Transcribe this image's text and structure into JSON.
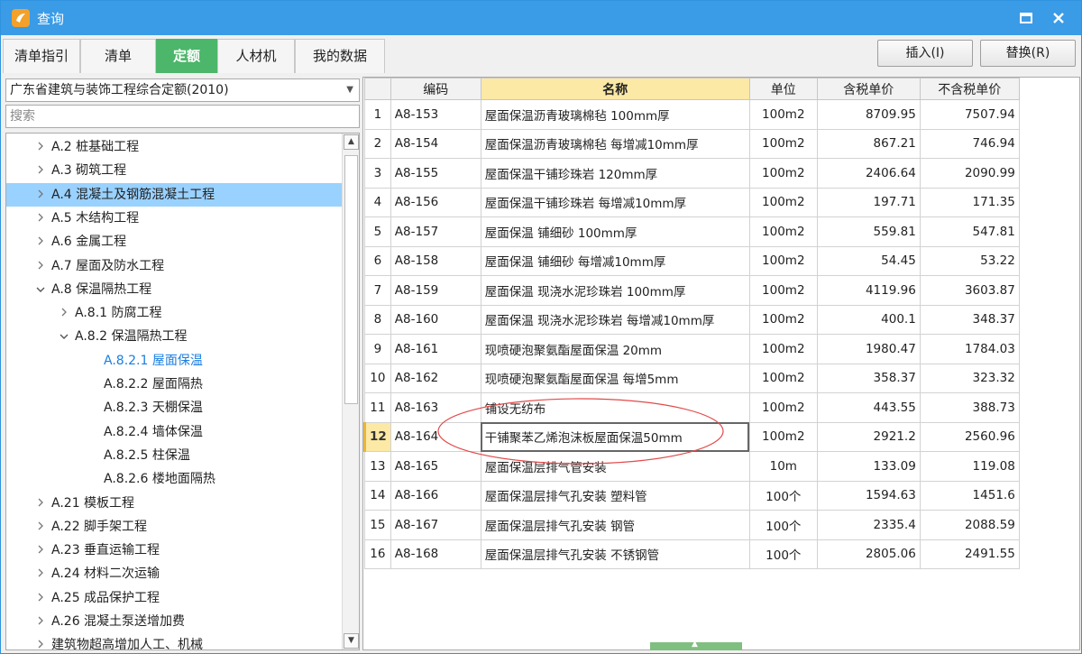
{
  "window": {
    "title": "查询",
    "title_bar_color": "#3a9be7",
    "maximize_icon": "maximize-icon",
    "close_icon": "close-icon"
  },
  "tabs": [
    {
      "label": "清单指引",
      "active": false
    },
    {
      "label": "清单",
      "active": false
    },
    {
      "label": "定额",
      "active": true
    },
    {
      "label": "人材机",
      "active": false
    },
    {
      "label": "我的数据",
      "active": false
    }
  ],
  "accent_color": "#4cb66a",
  "actions": {
    "insert": "插入(I)",
    "replace": "替换(R)"
  },
  "left": {
    "quota_library": "广东省建筑与装饰工程综合定额(2010)",
    "search_placeholder": "搜索",
    "tree": [
      {
        "label": "A.2 桩基础工程",
        "level": 1,
        "expand": "collapsed"
      },
      {
        "label": "A.3 砌筑工程",
        "level": 1,
        "expand": "collapsed"
      },
      {
        "label": "A.4 混凝土及钢筋混凝土工程",
        "level": 1,
        "expand": "collapsed",
        "selected": true
      },
      {
        "label": "A.5 木结构工程",
        "level": 1,
        "expand": "collapsed"
      },
      {
        "label": "A.6 金属工程",
        "level": 1,
        "expand": "collapsed"
      },
      {
        "label": "A.7 屋面及防水工程",
        "level": 1,
        "expand": "collapsed"
      },
      {
        "label": "A.8 保温隔热工程",
        "level": 1,
        "expand": "expanded"
      },
      {
        "label": "A.8.1 防腐工程",
        "level": 2,
        "expand": "collapsed"
      },
      {
        "label": "A.8.2 保温隔热工程",
        "level": 2,
        "expand": "expanded"
      },
      {
        "label": "A.8.2.1 屋面保温",
        "level": 3,
        "expand": "none",
        "active": true
      },
      {
        "label": "A.8.2.2 屋面隔热",
        "level": 3,
        "expand": "none"
      },
      {
        "label": "A.8.2.3 天棚保温",
        "level": 3,
        "expand": "none"
      },
      {
        "label": "A.8.2.4 墙体保温",
        "level": 3,
        "expand": "none"
      },
      {
        "label": "A.8.2.5 柱保温",
        "level": 3,
        "expand": "none"
      },
      {
        "label": "A.8.2.6 楼地面隔热",
        "level": 3,
        "expand": "none"
      },
      {
        "label": "A.21 模板工程",
        "level": 1,
        "expand": "collapsed"
      },
      {
        "label": "A.22 脚手架工程",
        "level": 1,
        "expand": "collapsed"
      },
      {
        "label": "A.23 垂直运输工程",
        "level": 1,
        "expand": "collapsed"
      },
      {
        "label": "A.24 材料二次运输",
        "level": 1,
        "expand": "collapsed"
      },
      {
        "label": "A.25 成品保护工程",
        "level": 1,
        "expand": "collapsed"
      },
      {
        "label": "A.26 混凝土泵送增加费",
        "level": 1,
        "expand": "collapsed"
      },
      {
        "label": "建筑物超高增加人工、机械",
        "level": 1,
        "expand": "collapsed"
      }
    ]
  },
  "grid": {
    "columns": [
      "编码",
      "名称",
      "单位",
      "含税单价",
      "不含税单价"
    ],
    "current_row": 12,
    "rows": [
      {
        "no": "1",
        "code": "A8-153",
        "name": "屋面保温沥青玻璃棉毡 100mm厚",
        "unit": "100m2",
        "price_tax": "8709.95",
        "price_notax": "7507.94"
      },
      {
        "no": "2",
        "code": "A8-154",
        "name": "屋面保温沥青玻璃棉毡 每增减10mm厚",
        "unit": "100m2",
        "price_tax": "867.21",
        "price_notax": "746.94"
      },
      {
        "no": "3",
        "code": "A8-155",
        "name": "屋面保温干铺珍珠岩 120mm厚",
        "unit": "100m2",
        "price_tax": "2406.64",
        "price_notax": "2090.99"
      },
      {
        "no": "4",
        "code": "A8-156",
        "name": "屋面保温干铺珍珠岩 每增减10mm厚",
        "unit": "100m2",
        "price_tax": "197.71",
        "price_notax": "171.35"
      },
      {
        "no": "5",
        "code": "A8-157",
        "name": "屋面保温 铺细砂 100mm厚",
        "unit": "100m2",
        "price_tax": "559.81",
        "price_notax": "547.81"
      },
      {
        "no": "6",
        "code": "A8-158",
        "name": "屋面保温 铺细砂 每增减10mm厚",
        "unit": "100m2",
        "price_tax": "54.45",
        "price_notax": "53.22"
      },
      {
        "no": "7",
        "code": "A8-159",
        "name": "屋面保温 现浇水泥珍珠岩 100mm厚",
        "unit": "100m2",
        "price_tax": "4119.96",
        "price_notax": "3603.87"
      },
      {
        "no": "8",
        "code": "A8-160",
        "name": "屋面保温 现浇水泥珍珠岩 每增减10mm厚",
        "unit": "100m2",
        "price_tax": "400.1",
        "price_notax": "348.37"
      },
      {
        "no": "9",
        "code": "A8-161",
        "name": "现喷硬泡聚氨酯屋面保温 20mm",
        "unit": "100m2",
        "price_tax": "1980.47",
        "price_notax": "1784.03"
      },
      {
        "no": "10",
        "code": "A8-162",
        "name": "现喷硬泡聚氨酯屋面保温 每增5mm",
        "unit": "100m2",
        "price_tax": "358.37",
        "price_notax": "323.32"
      },
      {
        "no": "11",
        "code": "A8-163",
        "name": "铺设无纺布",
        "unit": "100m2",
        "price_tax": "443.55",
        "price_notax": "388.73"
      },
      {
        "no": "12",
        "code": "A8-164",
        "name": "干铺聚苯乙烯泡沫板屋面保温50mm",
        "unit": "100m2",
        "price_tax": "2921.2",
        "price_notax": "2560.96"
      },
      {
        "no": "13",
        "code": "A8-165",
        "name": "屋面保温层排气管安装",
        "unit": "10m",
        "price_tax": "133.09",
        "price_notax": "119.08"
      },
      {
        "no": "14",
        "code": "A8-166",
        "name": "屋面保温层排气孔安装 塑料管",
        "unit": "100个",
        "price_tax": "1594.63",
        "price_notax": "1451.6"
      },
      {
        "no": "15",
        "code": "A8-167",
        "name": "屋面保温层排气孔安装 钢管",
        "unit": "100个",
        "price_tax": "2335.4",
        "price_notax": "2088.59"
      },
      {
        "no": "16",
        "code": "A8-168",
        "name": "屋面保温层排气孔安装 不锈钢管",
        "unit": "100个",
        "price_tax": "2805.06",
        "price_notax": "2491.55"
      }
    ]
  },
  "annotation_color": "#e24a4a"
}
